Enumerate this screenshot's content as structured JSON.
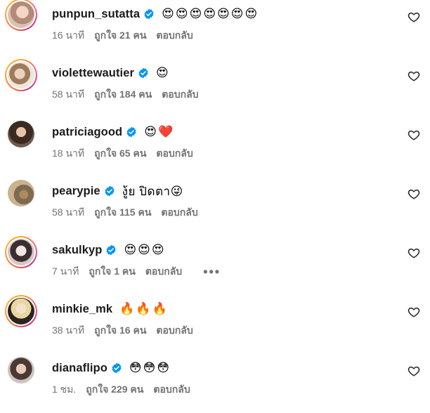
{
  "comments": [
    {
      "username": "punpun_sutatta",
      "text": "😍😍😍😍😍😍😍",
      "time": "16 นาที",
      "likes": "ถูกใจ 21 คน",
      "reply": "ตอบกลับ",
      "verified": true,
      "avatar_ring": "story"
    },
    {
      "username": "violettewautier",
      "text": "😍",
      "time": "58 นาที",
      "likes": "ถูกใจ 184 คน",
      "reply": "ตอบกลับ",
      "verified": true,
      "avatar_ring": "story"
    },
    {
      "username": "patriciagood",
      "text": "😍❤️",
      "time": "18 นาที",
      "likes": "ถูกใจ 65 คน",
      "reply": "ตอบกลับ",
      "verified": true,
      "avatar_ring": "none"
    },
    {
      "username": "pearypie",
      "text": "งู้ย ปิดตา😜",
      "time": "58 นาที",
      "likes": "ถูกใจ 115 คน",
      "reply": "ตอบกลับ",
      "verified": true,
      "avatar_ring": "none"
    },
    {
      "username": "sakulkyp",
      "text": "😍😍😍",
      "time": "7 นาที",
      "likes": "ถูกใจ 1 คน",
      "reply": "ตอบกลับ",
      "more": "•••",
      "verified": true,
      "avatar_ring": "story"
    },
    {
      "username": "minkie_mk",
      "text": "🔥🔥🔥",
      "time": "38 นาที",
      "likes": "ถูกใจ 16 คน",
      "reply": "ตอบกลับ",
      "verified": false,
      "avatar_ring": "story"
    },
    {
      "username": "dianaflipo",
      "text": "😳😳😳",
      "time": "1 ชม.",
      "likes": "ถูกใจ 229 คน",
      "reply": "ตอบกลับ",
      "verified": true,
      "avatar_ring": "none"
    }
  ],
  "icons": {
    "verified": "verified-badge-icon",
    "like": "heart-outline-icon",
    "more": "more-options-icon"
  },
  "colors": {
    "verified_blue": "#0095f6",
    "meta_gray": "#737373"
  }
}
